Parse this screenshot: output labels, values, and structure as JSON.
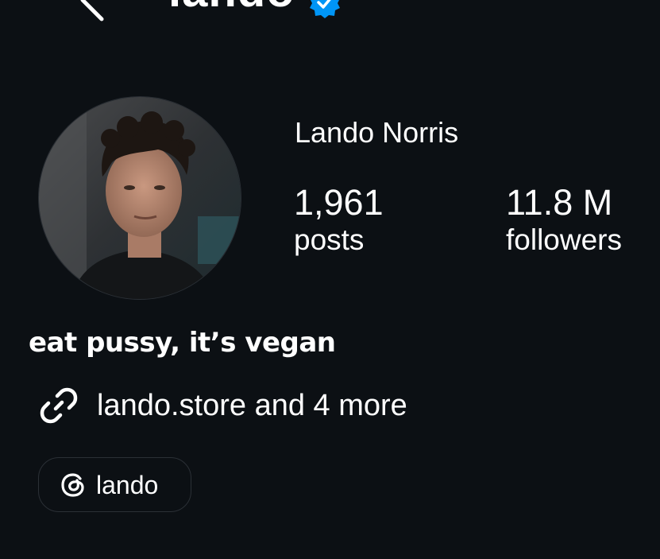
{
  "header": {
    "username": "lando",
    "back_icon": "chevron-left-icon",
    "verified_icon": "verified-badge-icon",
    "verified_color": "#0095f6"
  },
  "profile": {
    "display_name": "Lando Norris",
    "avatar_icon": "profile-photo",
    "stats": [
      {
        "value": "1,961",
        "label": "posts"
      },
      {
        "value": "11.8 M",
        "label": "followers"
      }
    ],
    "bio": "eat pussy, it’s vegan",
    "links": {
      "icon": "link-icon",
      "text": "lando.store and 4 more"
    },
    "threads": {
      "icon": "threads-icon",
      "label": "lando"
    }
  },
  "colors": {
    "background": "#0c1014",
    "text": "#ffffff",
    "chip_border": "#2b3036"
  }
}
